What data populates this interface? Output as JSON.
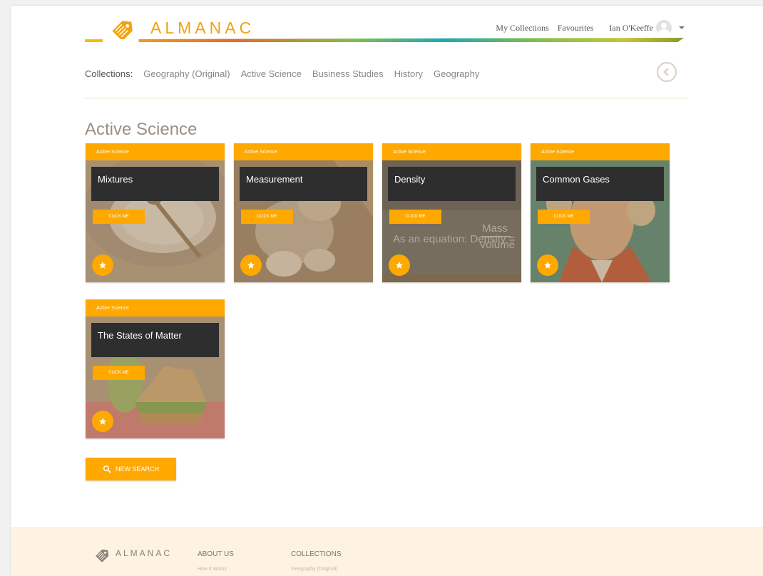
{
  "brand": {
    "name": "ALMANAC",
    "accent": "#fea800",
    "logo_text_color": "#f2a20d"
  },
  "topnav": {
    "links": [
      "My Collections",
      "Favourites"
    ],
    "user_name": "Ian O'Keeffe",
    "avatar_icon": "user-avatar-icon",
    "menu_icon": "caret-down-icon"
  },
  "collections": {
    "label": "Collections:",
    "items": [
      "Geography (Original)",
      "Active Science",
      "Business Studies",
      "History",
      "Geography"
    ],
    "back_icon": "chevron-left-circle-icon"
  },
  "section": {
    "title": "Active Science"
  },
  "cards": [
    {
      "tag": "Active Science",
      "title": "Mixtures",
      "button": "CLICK ME",
      "fav_icon": "star-icon"
    },
    {
      "tag": "Active Science",
      "title": "Measurement",
      "button": "CLICK ME",
      "fav_icon": "star-icon"
    },
    {
      "tag": "Active Science",
      "title": "Density",
      "button": "CLICK ME",
      "fav_icon": "star-icon",
      "image_text": {
        "prefix": "As an equation: Density =",
        "numerator": "Mass",
        "denominator": "Volume"
      }
    },
    {
      "tag": "Active Science",
      "title": "Common Gases",
      "button": "CLICK ME",
      "fav_icon": "star-icon"
    },
    {
      "tag": "Active Science",
      "title": "The States of Matter",
      "button": "CLICK ME",
      "fav_icon": "star-icon"
    }
  ],
  "new_search": {
    "label": "NEW SEARCH",
    "icon": "search-icon"
  },
  "footer": {
    "brand": "ALMANAC",
    "about": {
      "heading": "ABOUT US",
      "links": [
        "How it Works"
      ]
    },
    "collections": {
      "heading": "COLLECTIONS",
      "links": [
        "Geography (Original)"
      ]
    }
  }
}
